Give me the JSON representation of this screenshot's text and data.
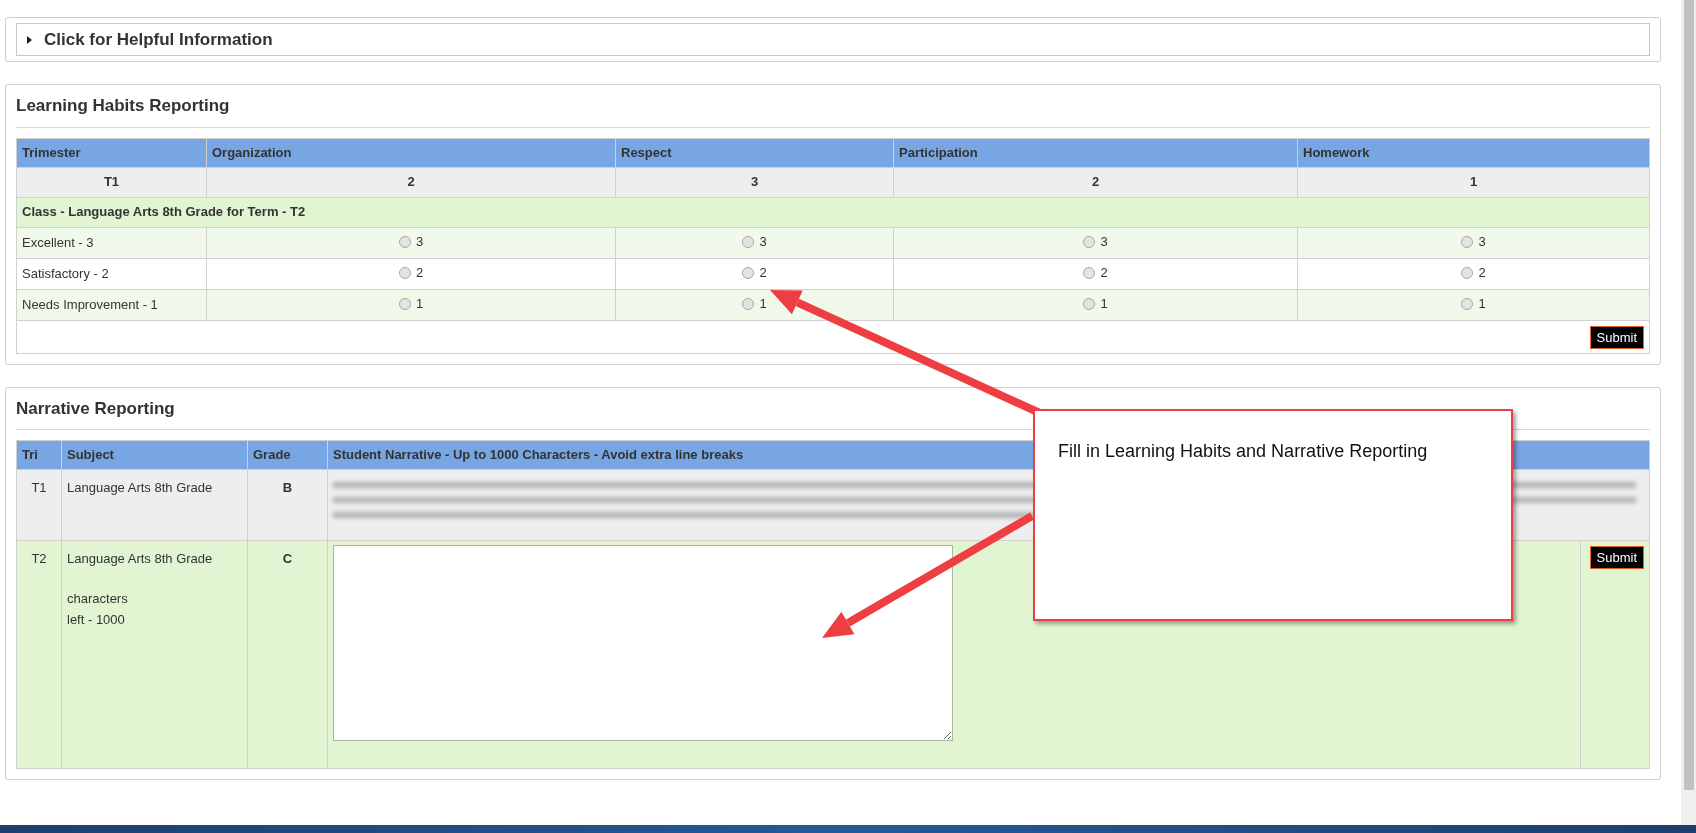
{
  "helpful_info": {
    "label": "Click for Helpful Information",
    "expanded": false
  },
  "learning_habits": {
    "title": "Learning Habits Reporting",
    "columns": [
      "Trimester",
      "Organization",
      "Respect",
      "Participation",
      "Homework"
    ],
    "summary_row": [
      "T1",
      "2",
      "3",
      "2",
      "1"
    ],
    "class_row": "Class - Language Arts 8th Grade for Term - T2",
    "rows": [
      {
        "label": "Excellent - 3",
        "options": [
          {
            "value": "3",
            "selected": false
          },
          {
            "value": "3",
            "selected": false
          },
          {
            "value": "3",
            "selected": false
          },
          {
            "value": "3",
            "selected": false
          }
        ]
      },
      {
        "label": "Satisfactory - 2",
        "options": [
          {
            "value": "2",
            "selected": false
          },
          {
            "value": "2",
            "selected": false
          },
          {
            "value": "2",
            "selected": false
          },
          {
            "value": "2",
            "selected": false
          }
        ]
      },
      {
        "label": "Needs Improvement - 1",
        "options": [
          {
            "value": "1",
            "selected": false
          },
          {
            "value": "1",
            "selected": false
          },
          {
            "value": "1",
            "selected": false
          },
          {
            "value": "1",
            "selected": false
          }
        ]
      }
    ],
    "submit": "Submit"
  },
  "narrative": {
    "title": "Narrative Reporting",
    "columns": [
      "Tri",
      "Subject",
      "Grade",
      "Student Narrative - Up to 1000 Characters - Avoid extra line breaks"
    ],
    "rows": [
      {
        "kind": "submitted",
        "tri": "T1",
        "subject": "Language Arts 8th Grade",
        "grade": "B"
      },
      {
        "kind": "editable",
        "tri": "T2",
        "subject": "Language Arts 8th Grade",
        "grade": "C",
        "counter_label": "characters",
        "counter": "left - 1000",
        "submit": "Submit"
      }
    ]
  },
  "callout": {
    "text": "Fill in Learning Habits and Narrative Reporting"
  }
}
